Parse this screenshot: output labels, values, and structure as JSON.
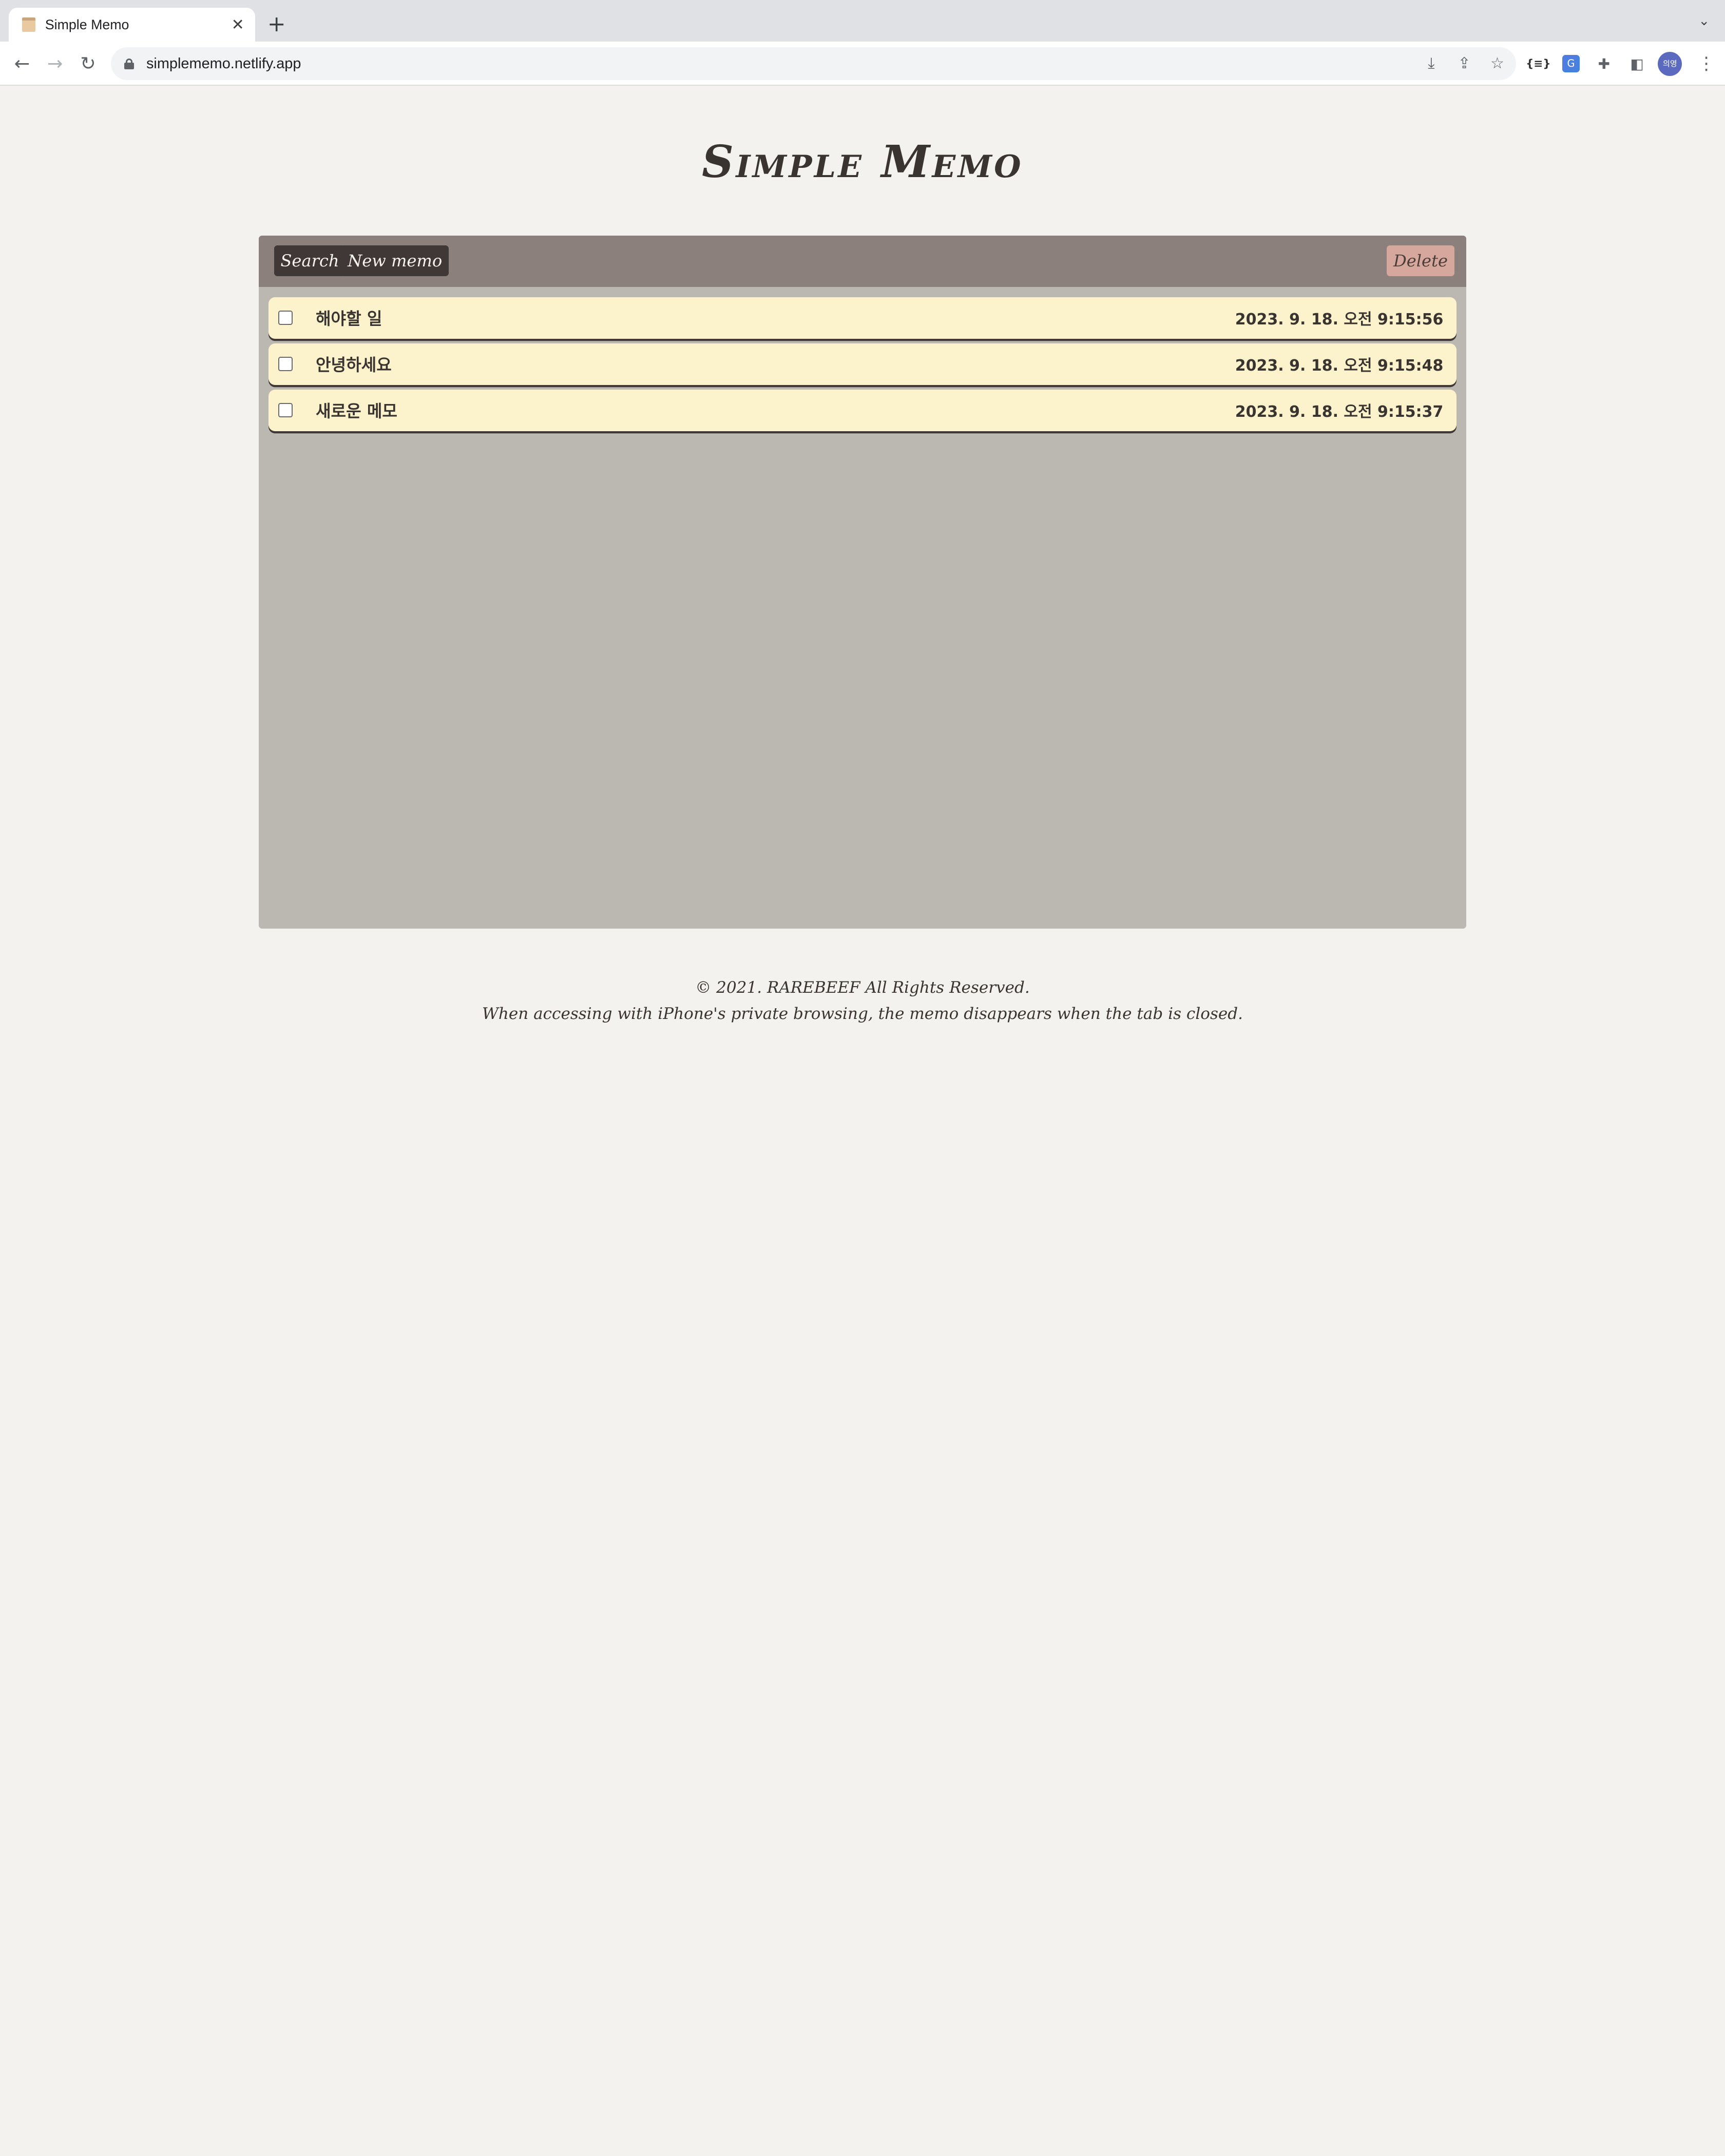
{
  "browser": {
    "tab_title": "Simple Memo",
    "tab_close": "✕",
    "new_tab": "+",
    "tab_list": "⌄",
    "url": "simplememo.netlify.app",
    "back": "←",
    "forward": "→",
    "reload": "↻",
    "omnibox_icons": [
      "download-icon",
      "share-icon",
      "star-icon"
    ],
    "extension_icons": [
      "braces-extension-icon",
      "translate-icon",
      "puzzle-icon",
      "sidepanel-icon"
    ],
    "avatar_text": "의영",
    "menu": "⋮",
    "braces_label": "{≡}",
    "translate_label": "G",
    "download_glyph": "⤓",
    "share_glyph": "⇪",
    "star_glyph": "☆",
    "puzzle_glyph": "✚",
    "sidepanel_glyph": "◧"
  },
  "app": {
    "title": "Simple Memo",
    "toolbar": {
      "search_label": "Search",
      "new_memo_label": "New memo",
      "delete_label": "Delete"
    },
    "memos": [
      {
        "title": "해야할 일",
        "date": "2023. 9. 18. 오전 9:15:56",
        "checked": false
      },
      {
        "title": "안녕하세요",
        "date": "2023. 9. 18. 오전 9:15:48",
        "checked": false
      },
      {
        "title": "새로운 메모",
        "date": "2023. 9. 18. 오전 9:15:37",
        "checked": false
      }
    ],
    "footer": {
      "copyright": "© 2021. RAREBEEF All Rights Reserved.",
      "notice": "When accessing with iPhone's private browsing, the memo disappears when the tab is closed."
    }
  },
  "colors": {
    "page_bg": "#f4f2ee",
    "panel_bg": "#bbb8b1",
    "panel_header": "#8b807c",
    "memo_bg": "#fcf2cc",
    "button_dark": "#3f3836",
    "delete_button": "#d6a79c",
    "text_dark": "#3a3431"
  }
}
